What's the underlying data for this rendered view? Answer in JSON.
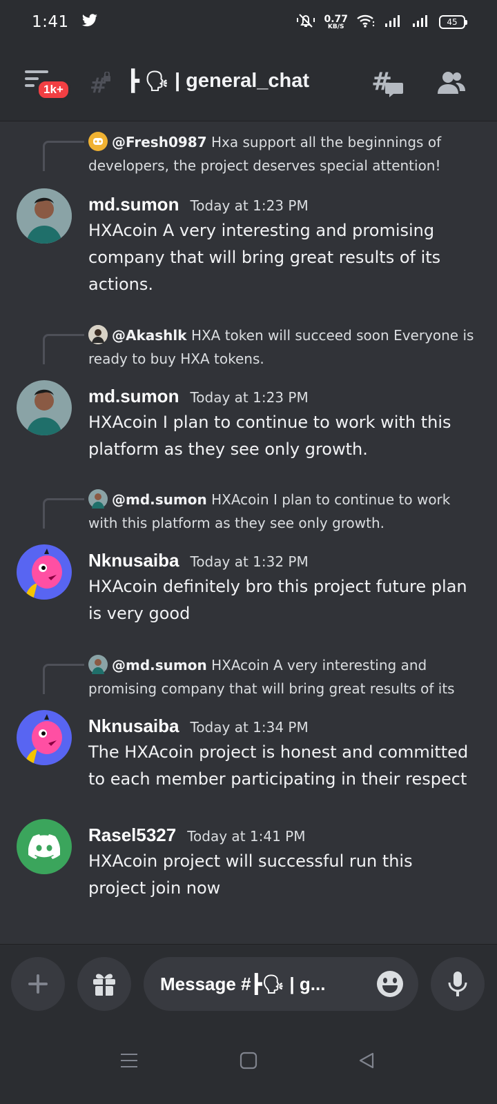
{
  "status_bar": {
    "time": "1:41",
    "net_speed_value": "0.77",
    "net_speed_unit": "KB/S",
    "battery": "45",
    "notification_app": "twitter-icon"
  },
  "header": {
    "unread_badge": "1k+",
    "channel_emoji": "🗣",
    "channel_name": "general_chat"
  },
  "messages": [
    {
      "reply": {
        "mention": "@Fresh0987",
        "text": "Hxa support all the beginnings of developers, the project deserves special attention!"
      },
      "author": "md.sumon",
      "time": "Today at 1:23 PM",
      "body": "HXAcoin A very interesting and promising company that will bring great results of its actions."
    },
    {
      "reply": {
        "mention": "@Akashlk",
        "text": "HXA token will succeed soon Everyone is ready to buy HXA tokens."
      },
      "author": "md.sumon",
      "time": "Today at 1:23 PM",
      "body": "HXAcoin I plan to continue to work with this platform as they see only growth."
    },
    {
      "reply": {
        "mention": "@md.sumon",
        "text": "HXAcoin I plan to continue to work with this platform as they see only growth."
      },
      "author": "Nknusaiba",
      "time": "Today at 1:32 PM",
      "body": "HXAcoin definitely bro this project future plan is very good"
    },
    {
      "reply": {
        "mention": "@md.sumon",
        "text": "HXAcoin A very interesting and promising company that will bring great results of its"
      },
      "author": "Nknusaiba",
      "time": "Today at 1:34 PM",
      "body": "The HXAcoin project is honest and committed to each member participating in their respect"
    },
    {
      "author": "Rasel5327",
      "time": "Today at 1:41 PM",
      "body": "HXAcoin project will successful run this project join now"
    }
  ],
  "composer": {
    "placeholder": "Message #┣🗣 | g..."
  },
  "colors": {
    "background": "#313338",
    "header": "#2b2d31",
    "input": "#383a40",
    "badge": "#f23f43",
    "discord_blurple": "#5865f2",
    "discord_green": "#3ba55c",
    "discord_orange": "#f0b232"
  }
}
